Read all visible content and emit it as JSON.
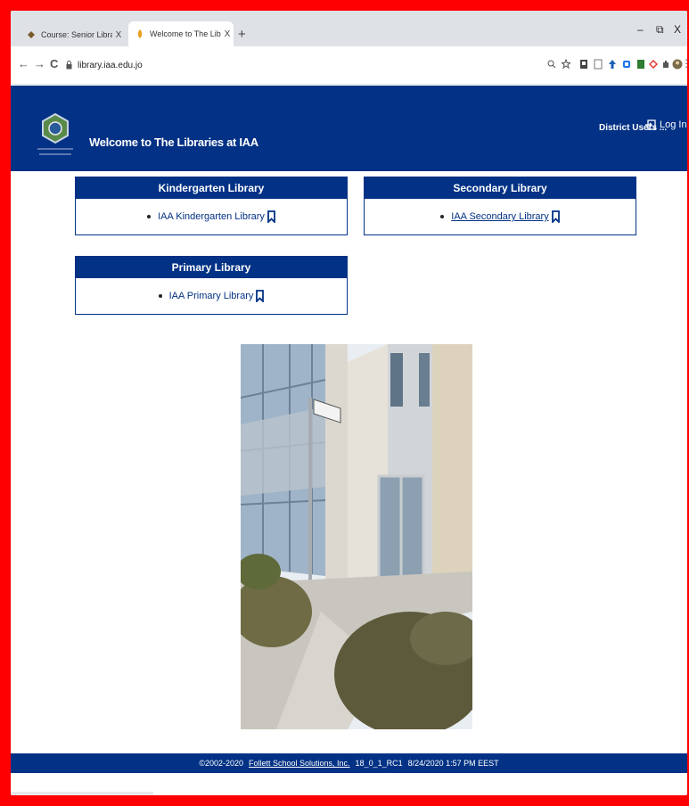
{
  "browser": {
    "tabs": [
      {
        "title": "Course: Senior Library",
        "close": "X"
      },
      {
        "title": "Welcome to The Libraries at IAA",
        "close": "X"
      }
    ],
    "new_tab": "+",
    "controls": {
      "minimize": "–",
      "maximize": "⧉",
      "close": "X"
    },
    "nav": {
      "back": "←",
      "forward": "→",
      "reload": "C"
    },
    "url": "library.iaa.edu.jo",
    "lock": "🔒"
  },
  "header": {
    "title": "Welcome to The Libraries at IAA",
    "district_users": "District Users ...",
    "login": "Log In"
  },
  "libraries": [
    {
      "heading": "Kindergarten Library",
      "link": "IAA Kindergarten Library"
    },
    {
      "heading": "Secondary Library",
      "link": "IAA Secondary Library"
    },
    {
      "heading": "Primary Library",
      "link": "IAA Primary Library"
    }
  ],
  "footer": {
    "copyright": "©2002-2020",
    "company": "Follett School Solutions, Inc.",
    "version": "18_0_1_RC1",
    "timestamp": "8/24/2020 1:57 PM EEST"
  },
  "colors": {
    "brand": "#023185",
    "frame": "#ff0000"
  }
}
